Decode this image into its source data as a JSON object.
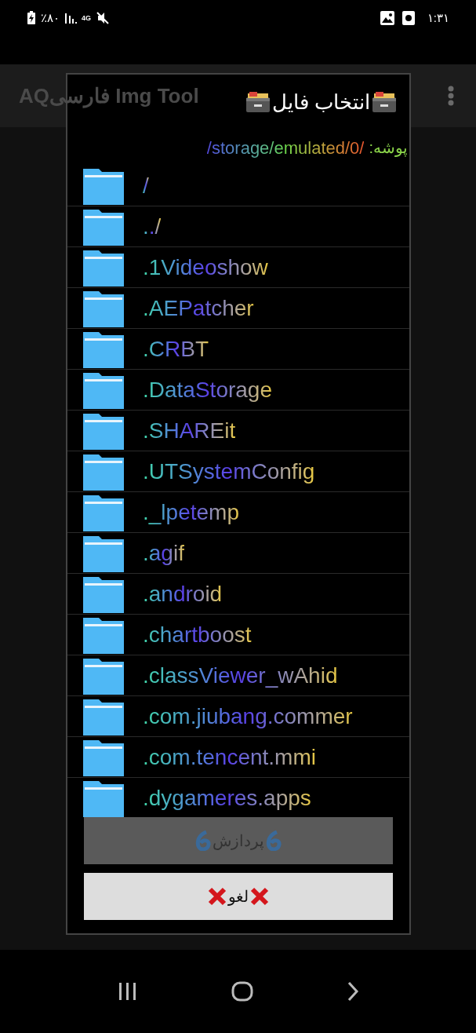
{
  "status_bar": {
    "battery": "٪۸۰",
    "network": "4G",
    "time": "۱:۳۱"
  },
  "app_bar": {
    "title": "AQفارسی Img Tool"
  },
  "dialog": {
    "title": "انتخاب فایل",
    "path_label": "پوشه:",
    "path": "/storage/emulated/0/",
    "items": [
      {
        "name": "/"
      },
      {
        "name": "../"
      },
      {
        "name": ".1Videoshow"
      },
      {
        "name": ".AEPatcher"
      },
      {
        "name": ".CRBT"
      },
      {
        "name": ".DataStorage"
      },
      {
        "name": ".SHAREit"
      },
      {
        "name": ".UTSystemConfig"
      },
      {
        "name": "._lpetemp"
      },
      {
        "name": ".agif"
      },
      {
        "name": ".android"
      },
      {
        "name": ".chartboost"
      },
      {
        "name": ".classViewer_wAhid"
      },
      {
        "name": ".com.jiubang.commer"
      },
      {
        "name": ".com.tencent.mmi"
      },
      {
        "name": ".dygameres.apps"
      }
    ],
    "buttons": [
      {
        "label": "پردازش",
        "kind": "process",
        "disabled": true
      },
      {
        "label": "لغو",
        "kind": "cancel",
        "disabled": false
      }
    ]
  }
}
